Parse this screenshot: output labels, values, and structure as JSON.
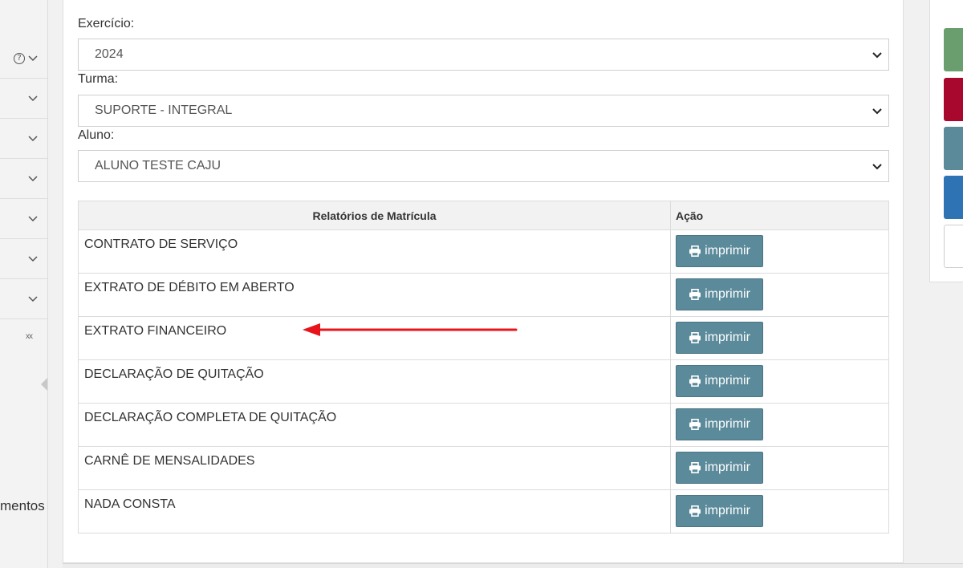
{
  "sidebar": {
    "bottom_text": "mentos",
    "collapsed_marker": "xx"
  },
  "form": {
    "exercicio": {
      "label": "Exercício:",
      "value": "2024"
    },
    "turma": {
      "label": "Turma:",
      "value": "SUPORTE - INTEGRAL"
    },
    "aluno": {
      "label": "Aluno:",
      "value": "ALUNO TESTE CAJU"
    }
  },
  "table": {
    "headers": [
      "Relatórios de Matrícula",
      "Ação"
    ],
    "rows": [
      {
        "name": "CONTRATO DE SERVIÇO",
        "action": "imprimir"
      },
      {
        "name": "EXTRATO DE DÉBITO EM ABERTO",
        "action": "imprimir"
      },
      {
        "name": "EXTRATO FINANCEIRO",
        "action": "imprimir"
      },
      {
        "name": "DECLARAÇÃO DE QUITAÇÃO",
        "action": "imprimir"
      },
      {
        "name": "DECLARAÇÃO COMPLETA DE QUITAÇÃO",
        "action": "imprimir"
      },
      {
        "name": "CARNÊ DE MENSALIDADES",
        "action": "imprimir"
      },
      {
        "name": "NADA CONSTA",
        "action": "imprimir"
      }
    ]
  },
  "colors": {
    "button": "#5b8a9a",
    "annotation_arrow": "#e8141c",
    "swatches": [
      "#6b9e6e",
      "#a8082e",
      "#5b8a9a",
      "#2e74b5"
    ]
  }
}
